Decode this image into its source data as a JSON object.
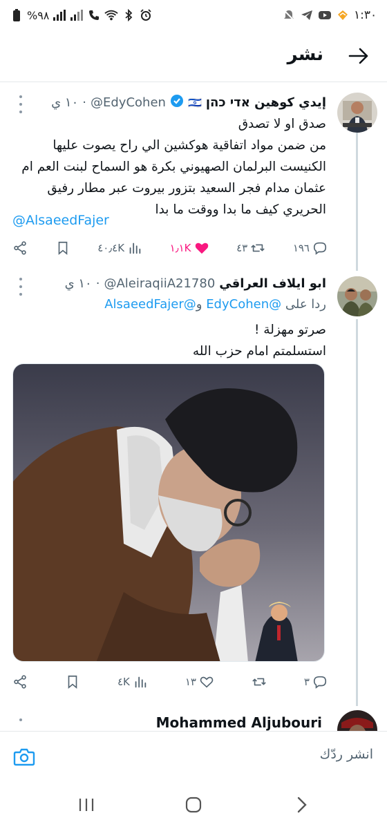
{
  "status_bar": {
    "time": "١:٣٠",
    "battery": "%٩٨"
  },
  "header": {
    "title": "نشر",
    "back_icon": "arrow-right-icon"
  },
  "tweets": [
    {
      "name": "إيدي كوهين אדי כהן",
      "flag": "🇮🇱",
      "handle": "@EdyCohen",
      "time": "١٠ ي",
      "body_lines": [
        "صدق او لا تصدق",
        "من ضمن مواد اتفاقية هوكشين الي راح يصوت عليها",
        "الكنيست البرلمان الصهيوني بكرة هو السماح لبنت العم ام",
        "عثمان مدام فجر السعيد بتزور بيروت عبر مطار رفيق",
        "الحريري كيف ما بدا ووقت ما بدا"
      ],
      "mention": "@AlsaeedFajer",
      "actions": {
        "replies": "١٩٦",
        "reposts": "٤٣",
        "likes": "١٫١K",
        "views": "٤٠٫٤K"
      }
    },
    {
      "name": "ابو ايلاف العراقي",
      "handle": "@AleiraqiiA21780",
      "time": "١٠ ي",
      "replying_prefix": "ردا على",
      "replying_to_1": "@EdyCohen",
      "replying_and": "و",
      "replying_to_2": "@AlsaeedFajer",
      "body_lines": [
        "صرتو مهزلة !",
        "استسلمتم امام حزب الله"
      ],
      "actions": {
        "replies": "٣",
        "reposts": "",
        "likes": "١٣",
        "views": "٤K"
      }
    },
    {
      "name": "Mohammed Aljubouri"
    }
  ],
  "reply_box": {
    "placeholder": "انشر ردّك"
  },
  "colors": {
    "accent": "#1d9bf0",
    "like": "#f91880",
    "secondary_text": "#536471"
  }
}
